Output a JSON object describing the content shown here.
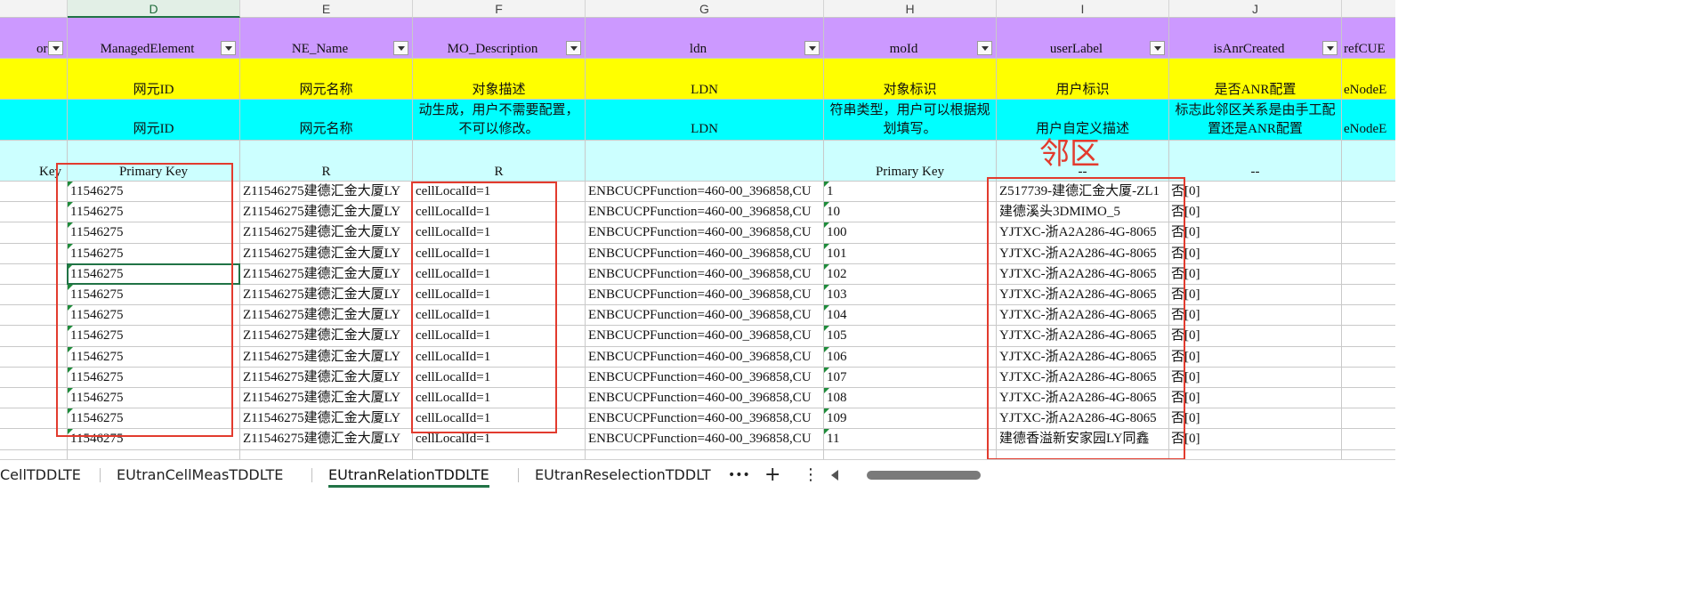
{
  "columns": [
    {
      "letter": "",
      "key": "c"
    },
    {
      "letter": "D",
      "key": "d"
    },
    {
      "letter": "E",
      "key": "e"
    },
    {
      "letter": "F",
      "key": "f"
    },
    {
      "letter": "G",
      "key": "g"
    },
    {
      "letter": "H",
      "key": "h"
    },
    {
      "letter": "I",
      "key": "i"
    },
    {
      "letter": "J",
      "key": "j"
    },
    {
      "letter": "",
      "key": "k"
    }
  ],
  "header_rows": {
    "field_names": {
      "c": "ork",
      "d": "ManagedElement",
      "e": "NE_Name",
      "f": "MO_Description",
      "g": "ldn",
      "h": "moId",
      "i": "userLabel",
      "j": "isAnrCreated",
      "k": "refCUE"
    },
    "chinese_names": {
      "c": "",
      "d": "网元ID",
      "e": "网元名称",
      "f": "对象描述",
      "g": "LDN",
      "h": "对象标识",
      "i": "用户标识",
      "j": "是否ANR配置",
      "k": "eNodeE"
    },
    "descriptions": {
      "c": "",
      "d": "网元ID",
      "e": "网元名称",
      "f": "动生成，用户不需要配置，不可以修改。",
      "g": "LDN",
      "h": "符串类型，用户可以根据规划填写。",
      "i": "用户自定义描述",
      "j": "标志此邻区关系是由手工配置还是ANR配置",
      "k": "eNodeE"
    },
    "key_flags": {
      "c": "Key",
      "d": "Primary Key",
      "e": "R",
      "f": "R",
      "g": "",
      "h": "Primary Key",
      "i": "--",
      "j": "--",
      "k": ""
    }
  },
  "data_rows": [
    {
      "d": "11546275",
      "e": "Z11546275建德汇金大厦LY",
      "f": "cellLocalId=1",
      "g": "ENBCUCPFunction=460-00_396858,CU",
      "h": "1",
      "i": "Z517739-建德汇金大厦-ZL1",
      "j": "否[0]"
    },
    {
      "d": "11546275",
      "e": "Z11546275建德汇金大厦LY",
      "f": "cellLocalId=1",
      "g": "ENBCUCPFunction=460-00_396858,CU",
      "h": "10",
      "i": "建德溪头3DMIMO_5",
      "j": "否[0]"
    },
    {
      "d": "11546275",
      "e": "Z11546275建德汇金大厦LY",
      "f": "cellLocalId=1",
      "g": "ENBCUCPFunction=460-00_396858,CU",
      "h": "100",
      "i": "YJTXC-浙A2A286-4G-8065",
      "j": "否[0]"
    },
    {
      "d": "11546275",
      "e": "Z11546275建德汇金大厦LY",
      "f": "cellLocalId=1",
      "g": "ENBCUCPFunction=460-00_396858,CU",
      "h": "101",
      "i": "YJTXC-浙A2A286-4G-8065",
      "j": "否[0]"
    },
    {
      "d": "11546275",
      "e": "Z11546275建德汇金大厦LY",
      "f": "cellLocalId=1",
      "g": "ENBCUCPFunction=460-00_396858,CU",
      "h": "102",
      "i": "YJTXC-浙A2A286-4G-8065",
      "j": "否[0]"
    },
    {
      "d": "11546275",
      "e": "Z11546275建德汇金大厦LY",
      "f": "cellLocalId=1",
      "g": "ENBCUCPFunction=460-00_396858,CU",
      "h": "103",
      "i": "YJTXC-浙A2A286-4G-8065",
      "j": "否[0]"
    },
    {
      "d": "11546275",
      "e": "Z11546275建德汇金大厦LY",
      "f": "cellLocalId=1",
      "g": "ENBCUCPFunction=460-00_396858,CU",
      "h": "104",
      "i": "YJTXC-浙A2A286-4G-8065",
      "j": "否[0]"
    },
    {
      "d": "11546275",
      "e": "Z11546275建德汇金大厦LY",
      "f": "cellLocalId=1",
      "g": "ENBCUCPFunction=460-00_396858,CU",
      "h": "105",
      "i": "YJTXC-浙A2A286-4G-8065",
      "j": "否[0]"
    },
    {
      "d": "11546275",
      "e": "Z11546275建德汇金大厦LY",
      "f": "cellLocalId=1",
      "g": "ENBCUCPFunction=460-00_396858,CU",
      "h": "106",
      "i": "YJTXC-浙A2A286-4G-8065",
      "j": "否[0]"
    },
    {
      "d": "11546275",
      "e": "Z11546275建德汇金大厦LY",
      "f": "cellLocalId=1",
      "g": "ENBCUCPFunction=460-00_396858,CU",
      "h": "107",
      "i": "YJTXC-浙A2A286-4G-8065",
      "j": "否[0]"
    },
    {
      "d": "11546275",
      "e": "Z11546275建德汇金大厦LY",
      "f": "cellLocalId=1",
      "g": "ENBCUCPFunction=460-00_396858,CU",
      "h": "108",
      "i": "YJTXC-浙A2A286-4G-8065",
      "j": "否[0]"
    },
    {
      "d": "11546275",
      "e": "Z11546275建德汇金大厦LY",
      "f": "cellLocalId=1",
      "g": "ENBCUCPFunction=460-00_396858,CU",
      "h": "109",
      "i": "YJTXC-浙A2A286-4G-8065",
      "j": "否[0]"
    },
    {
      "d": "11546275",
      "e": "Z11546275建德汇金大厦LY",
      "f": "cellLocalId=1",
      "g": "ENBCUCPFunction=460-00_396858,CU",
      "h": "11",
      "i": "建德香溢新安家园LY同鑫",
      "j": "否[0]"
    },
    {
      "d": "",
      "e": "",
      "f": "",
      "g": "",
      "h": "",
      "i": "",
      "j": ""
    }
  ],
  "annotation": {
    "label": "邻区"
  },
  "sheet_tabs": [
    {
      "label": "CellTDDLTE",
      "active": false
    },
    {
      "label": "EUtranCellMeasTDDLTE",
      "active": false
    },
    {
      "label": "EUtranRelationTDDLTE",
      "active": true
    },
    {
      "label": "EUtranReselectionTDDLT",
      "active": false
    }
  ],
  "tab_controls": {
    "more": "•••",
    "add": "+",
    "menu": "⋮"
  },
  "colors": {
    "purple": "#cc99ff",
    "yellow": "#ffff00",
    "cyan": "#00ffff",
    "light_cyan": "#ccffff",
    "annotation_red": "#e23b2e",
    "excel_green": "#217346"
  }
}
